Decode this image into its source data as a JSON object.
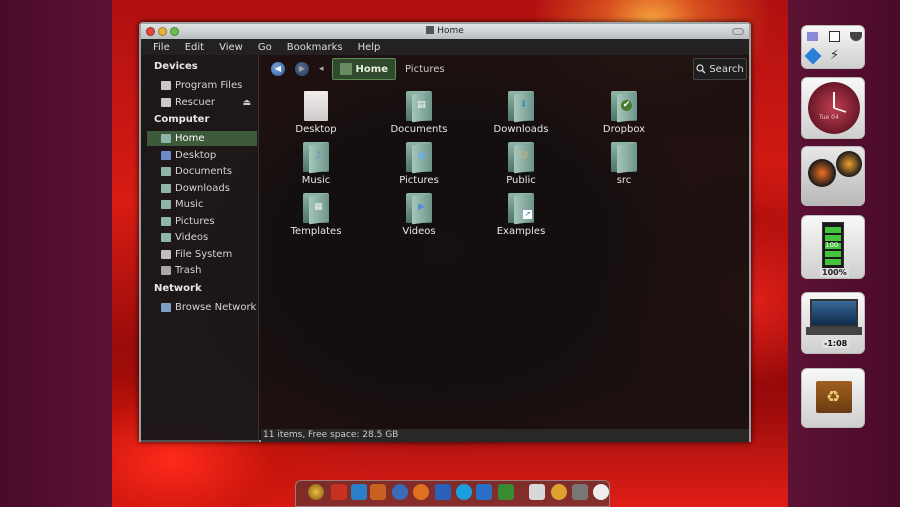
{
  "window": {
    "title": "Home",
    "menu": [
      "File",
      "Edit",
      "View",
      "Go",
      "Bookmarks",
      "Help"
    ]
  },
  "sidebar": {
    "devices_heading": "Devices",
    "devices": [
      {
        "label": "Program Files",
        "icon": "drive-icon"
      },
      {
        "label": "Rescuer",
        "icon": "drive-icon"
      }
    ],
    "computer_heading": "Computer",
    "computer": [
      {
        "label": "Home",
        "icon": "home-folder-icon"
      },
      {
        "label": "Desktop",
        "icon": "desktop-icon"
      },
      {
        "label": "Documents",
        "icon": "documents-icon"
      },
      {
        "label": "Downloads",
        "icon": "downloads-icon"
      },
      {
        "label": "Music",
        "icon": "music-icon"
      },
      {
        "label": "Pictures",
        "icon": "pictures-icon"
      },
      {
        "label": "Videos",
        "icon": "videos-icon"
      },
      {
        "label": "File System",
        "icon": "filesystem-icon"
      },
      {
        "label": "Trash",
        "icon": "trash-icon"
      }
    ],
    "network_heading": "Network",
    "network": [
      {
        "label": "Browse Network",
        "icon": "network-icon"
      }
    ]
  },
  "toolbar": {
    "breadcrumb_current": "Home",
    "breadcrumb_next": "Pictures",
    "search_label": "Search"
  },
  "files": [
    {
      "label": "Desktop",
      "icon": "document-icon"
    },
    {
      "label": "Documents",
      "icon": "folder-documents-icon"
    },
    {
      "label": "Downloads",
      "icon": "folder-downloads-icon"
    },
    {
      "label": "Dropbox",
      "icon": "folder-dropbox-icon"
    },
    {
      "label": "Music",
      "icon": "folder-music-icon"
    },
    {
      "label": "Pictures",
      "icon": "folder-pictures-icon"
    },
    {
      "label": "Public",
      "icon": "folder-public-icon"
    },
    {
      "label": "src",
      "icon": "folder-icon"
    },
    {
      "label": "Templates",
      "icon": "folder-templates-icon"
    },
    {
      "label": "Videos",
      "icon": "folder-videos-icon"
    },
    {
      "label": "Examples",
      "icon": "folder-link-icon"
    }
  ],
  "status": "11 items, Free space: 28.5 GB",
  "widgets": {
    "clock_date": "Tue 04",
    "battery_percent": "100%",
    "battery_level": 1.0,
    "battery_digits": "100",
    "media_time": "-1:08"
  },
  "colors": {
    "selection": "#3d5a3a",
    "accent_green": "#5b8a52"
  }
}
